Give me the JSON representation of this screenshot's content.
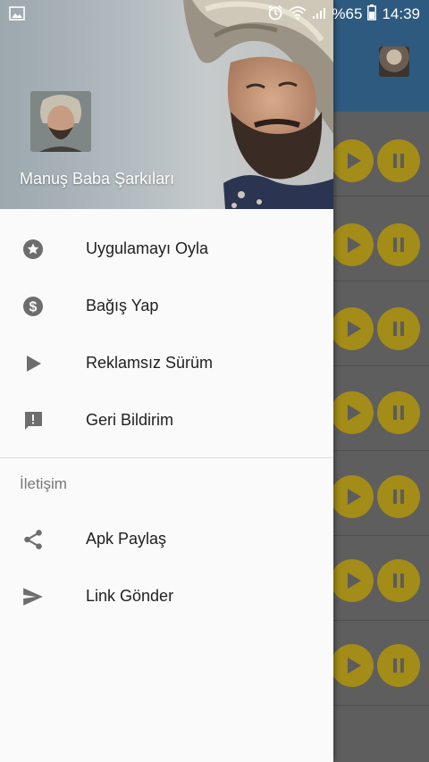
{
  "status_bar": {
    "battery_percent": "%65",
    "time": "14:39"
  },
  "drawer": {
    "header_title": "Manuş Baba Şarkıları",
    "menu_items": [
      {
        "label": "Uygulamayı Oyla",
        "icon": "star-badge-icon"
      },
      {
        "label": "Bağış Yap",
        "icon": "dollar-circle-icon"
      },
      {
        "label": "Reklamsız Sürüm",
        "icon": "play-icon"
      },
      {
        "label": "Geri Bildirim",
        "icon": "feedback-icon"
      }
    ],
    "section_title": "İletişim",
    "contact_items": [
      {
        "label": "Apk Paylaş",
        "icon": "share-icon"
      },
      {
        "label": "Link Gönder",
        "icon": "send-icon"
      }
    ]
  },
  "colors": {
    "toolbar": "#2e5a7f",
    "dimmed_play_button": "#a38c17"
  }
}
